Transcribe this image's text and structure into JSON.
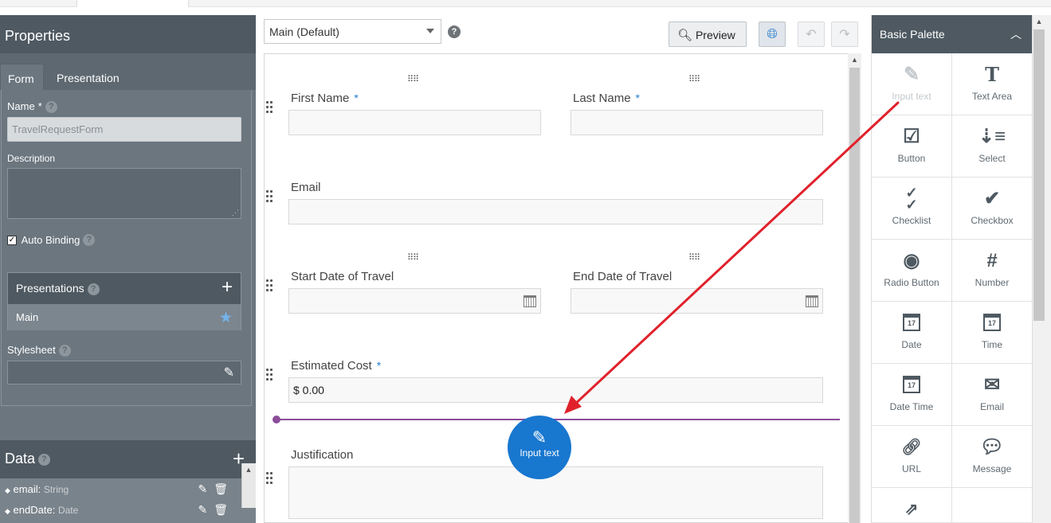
{
  "properties": {
    "title": "Properties",
    "tabs": [
      "Form",
      "Presentation"
    ],
    "name_label": "Name",
    "name_value": "TravelRequestForm",
    "description_label": "Description",
    "auto_binding_label": "Auto Binding",
    "auto_binding_checked": true,
    "presentations_label": "Presentations",
    "presentations": [
      {
        "label": "Main",
        "is_default": true
      }
    ],
    "stylesheet_label": "Stylesheet"
  },
  "data_section": {
    "title": "Data",
    "items": [
      {
        "name": "email",
        "type": "String"
      },
      {
        "name": "endDate",
        "type": "Date"
      }
    ]
  },
  "toolbar": {
    "presentation_select_value": "Main (Default)",
    "preview_label": "Preview"
  },
  "form": {
    "fields": {
      "first_name": {
        "label": "First Name",
        "required": "*"
      },
      "last_name": {
        "label": "Last Name",
        "required": "*"
      },
      "email": {
        "label": "Email"
      },
      "start_date": {
        "label": "Start Date of Travel"
      },
      "end_date": {
        "label": "End Date of Travel"
      },
      "estimated_cost": {
        "label": "Estimated Cost",
        "required": "*",
        "value": "$ 0.00"
      },
      "justification": {
        "label": "Justification"
      }
    },
    "drag_item_label": "Input text"
  },
  "palette": {
    "title": "Basic Palette",
    "items": [
      {
        "label": "Input text",
        "icon": "pencil-icon"
      },
      {
        "label": "Text Area",
        "icon": "text-area-icon"
      },
      {
        "label": "Button",
        "icon": "button-icon"
      },
      {
        "label": "Select",
        "icon": "select-icon"
      },
      {
        "label": "Checklist",
        "icon": "checklist-icon"
      },
      {
        "label": "Checkbox",
        "icon": "checkbox-icon"
      },
      {
        "label": "Radio Button",
        "icon": "radio-button-icon"
      },
      {
        "label": "Number",
        "icon": "number-icon"
      },
      {
        "label": "Date",
        "icon": "calendar-icon"
      },
      {
        "label": "Time",
        "icon": "calendar-icon"
      },
      {
        "label": "Date Time",
        "icon": "calendar-icon"
      },
      {
        "label": "Email",
        "icon": "envelope-icon"
      },
      {
        "label": "URL",
        "icon": "link-icon"
      },
      {
        "label": "Message",
        "icon": "speech-bubble-icon"
      },
      {
        "label": "",
        "icon": "external-link-icon"
      }
    ]
  },
  "colors": {
    "panel_dark": "#4e5961",
    "panel": "#6b767f",
    "accent_blue": "#1877cf",
    "drop_line": "#8b4c9b",
    "annotation_arrow": "#e0212b"
  }
}
